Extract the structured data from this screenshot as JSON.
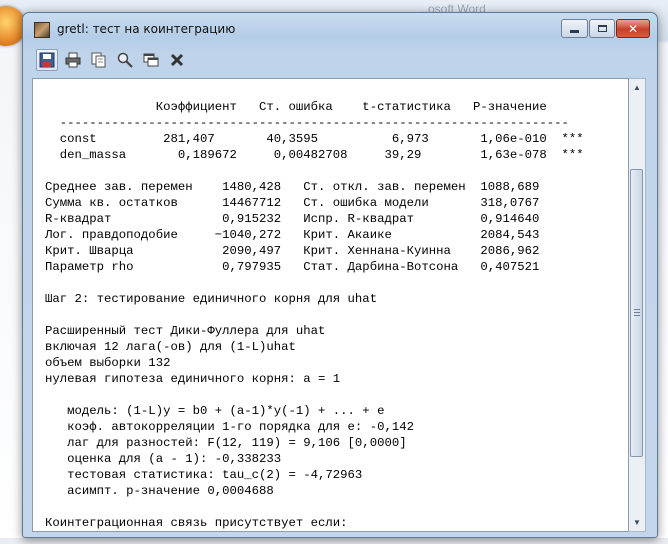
{
  "window": {
    "title": "gretl: тест на коинтеграцию",
    "background_title_fragment": "...osoft Word",
    "background_right_text": "e r"
  },
  "toolbar": {
    "buttons": [
      {
        "name": "save-icon"
      },
      {
        "name": "print-icon"
      },
      {
        "name": "copy-icon"
      },
      {
        "name": "find-icon"
      },
      {
        "name": "windows-icon"
      },
      {
        "name": "close-icon"
      }
    ]
  },
  "output": {
    "text": "               Коэффициент   Ст. ошибка    t-статистика   P-значение\n  ---------------------------------------------------------------------\n  const         281,407       40,3595          6,973       1,06e-010  ***\n  den_massa       0,189672     0,00482708     39,29        1,63e-078  ***\n\nСреднее зав. перемен    1480,428   Ст. откл. зав. перемен  1088,689\nСумма кв. остатков      14467712   Ст. ошибка модели       318,0767\nR-квадрат               0,915232   Испр. R-квадрат         0,914640\nЛог. правдоподобие     −1040,272   Крит. Акаике            2084,543\nКрит. Шварца            2090,497   Крит. Хеннана-Куинна    2086,962\nПараметр rho            0,797935   Стат. Дарбина-Вотсона   0,407521\n\nШаг 2: тестирование единичного корня для uhat\n\nРасширенный тест Дики-Фуллера для uhat\nвключая 12 лага(-ов) для (1-L)uhat\nобъем выборки 132\nнулевая гипотеза единичного корня: a = 1\n\n   модель: (1-L)y = b0 + (a-1)*y(-1) + ... + e\n   коэф. автокорреляции 1-го порядка для e: -0,142\n   лаг для разностей: F(12, 119) = 9,106 [0,0000]\n   оценка для (a - 1): -0,338233\n   тестовая статистика: tau_c(2) = -4,72963\n   асимпт. р-значение 0,0004688\n\nКоинтеграционная связь присутствует если:"
  },
  "colors": {
    "window_frame": "#bfd3ea",
    "close_button": "#c7412b",
    "text_bg": "#ffffff"
  }
}
